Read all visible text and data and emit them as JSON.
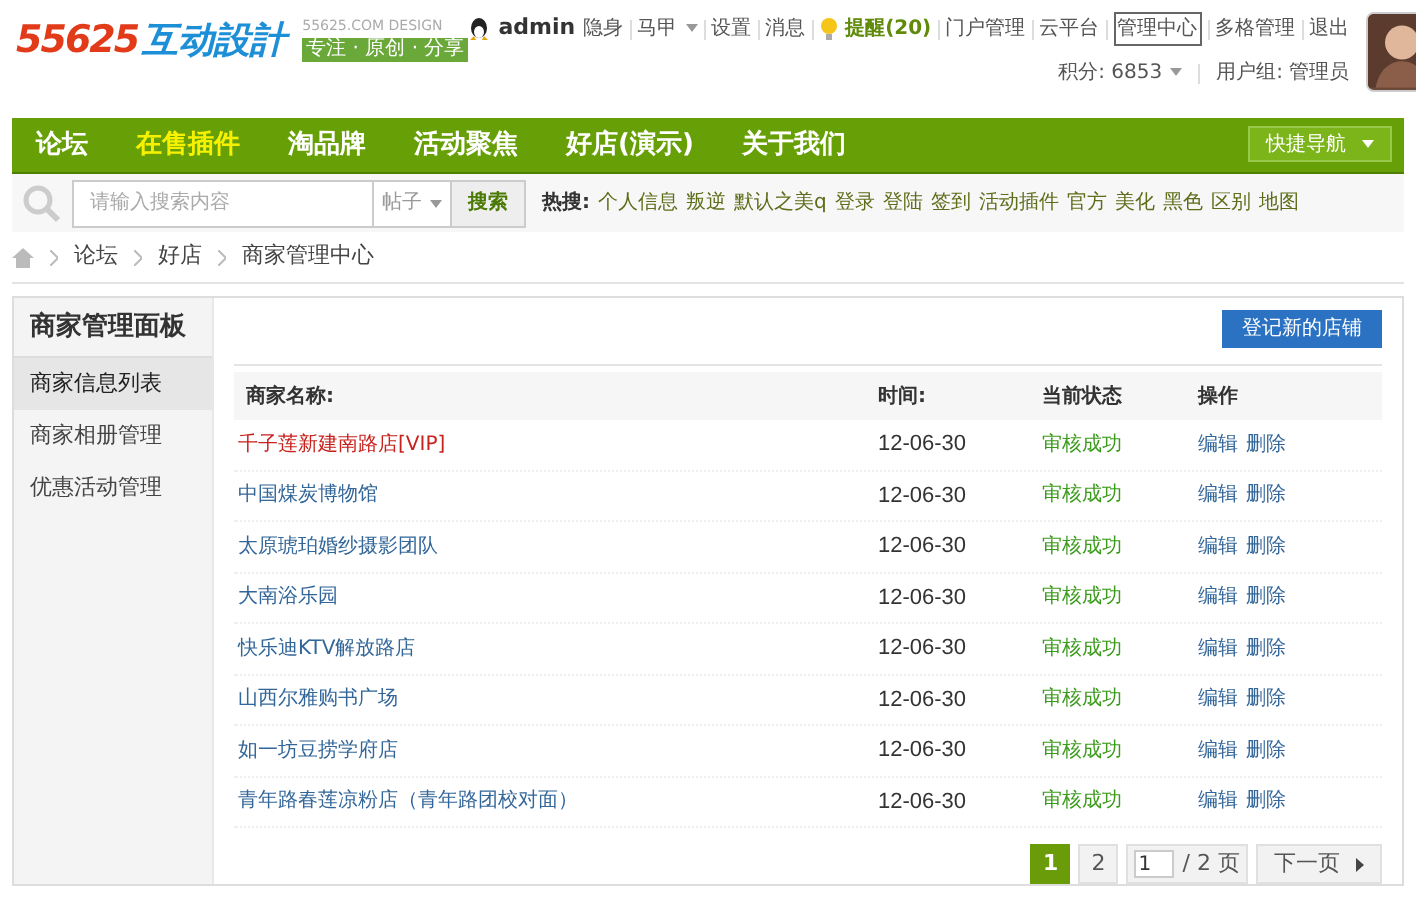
{
  "logo": {
    "digits": "55625",
    "brand": "互动設計",
    "domain": "55625.COM DESIGN",
    "slogan": "专注 · 原创 · 分享"
  },
  "user_bar": {
    "username": "admin",
    "status": "隐身",
    "links": [
      {
        "label": "马甲",
        "kind": "dropdown",
        "boxed": false
      },
      {
        "label": "设置",
        "kind": "link",
        "boxed": false
      },
      {
        "label": "消息",
        "kind": "link",
        "boxed": false
      },
      {
        "label": "提醒(20)",
        "kind": "alert",
        "boxed": false
      },
      {
        "label": "门户管理",
        "kind": "link",
        "boxed": false
      },
      {
        "label": "云平台",
        "kind": "link",
        "boxed": false
      },
      {
        "label": "管理中心",
        "kind": "link",
        "boxed": true
      },
      {
        "label": "多格管理",
        "kind": "link",
        "boxed": false
      },
      {
        "label": "退出",
        "kind": "link",
        "boxed": false
      }
    ],
    "points": "积分: 6853",
    "group": "用户组: 管理员"
  },
  "nav": {
    "items": [
      {
        "label": "论坛",
        "selected": false
      },
      {
        "label": "在售插件",
        "selected": true
      },
      {
        "label": "淘品牌",
        "selected": false
      },
      {
        "label": "活动聚焦",
        "selected": false
      },
      {
        "label": "好店(演示)",
        "selected": false
      },
      {
        "label": "关于我们",
        "selected": false
      }
    ],
    "quick_nav": "快捷导航"
  },
  "search": {
    "placeholder": "请输入搜索内容",
    "scope": "帖子",
    "button": "搜索",
    "hot_label": "热搜:",
    "hot": [
      "个人信息",
      "叛逆",
      "默认之美q",
      "登录",
      "登陆",
      "签到",
      "活动插件",
      "官方",
      "美化",
      "黑色",
      "区别",
      "地图"
    ]
  },
  "breadcrumb": [
    "论坛",
    "好店",
    "商家管理中心"
  ],
  "sidebar": {
    "title": "商家管理面板",
    "items": [
      {
        "label": "商家信息列表",
        "selected": true
      },
      {
        "label": "商家相册管理",
        "selected": false
      },
      {
        "label": "优惠活动管理",
        "selected": false
      }
    ]
  },
  "register_button": "登记新的店铺",
  "table": {
    "columns": [
      "商家名称:",
      "时间:",
      "当前状态",
      "操作"
    ],
    "rows": [
      {
        "name": "千子莲新建南路店[VIP]",
        "vip": true,
        "time": "12-06-30",
        "status": "审核成功",
        "actions": [
          "编辑",
          "删除"
        ]
      },
      {
        "name": "中国煤炭博物馆",
        "vip": false,
        "time": "12-06-30",
        "status": "审核成功",
        "actions": [
          "编辑",
          "删除"
        ]
      },
      {
        "name": "太原琥珀婚纱摄影团队",
        "vip": false,
        "time": "12-06-30",
        "status": "审核成功",
        "actions": [
          "编辑",
          "删除"
        ]
      },
      {
        "name": "大南浴乐园",
        "vip": false,
        "time": "12-06-30",
        "status": "审核成功",
        "actions": [
          "编辑",
          "删除"
        ]
      },
      {
        "name": "快乐迪KTV解放路店",
        "vip": false,
        "time": "12-06-30",
        "status": "审核成功",
        "actions": [
          "编辑",
          "删除"
        ]
      },
      {
        "name": "山西尔雅购书广场",
        "vip": false,
        "time": "12-06-30",
        "status": "审核成功",
        "actions": [
          "编辑",
          "删除"
        ]
      },
      {
        "name": "如一坊豆捞学府店",
        "vip": false,
        "time": "12-06-30",
        "status": "审核成功",
        "actions": [
          "编辑",
          "删除"
        ]
      },
      {
        "name": "青年路春莲凉粉店（青年路团校对面）",
        "vip": false,
        "time": "12-06-30",
        "status": "审核成功",
        "actions": [
          "编辑",
          "删除"
        ]
      }
    ]
  },
  "pagination": {
    "pages": [
      {
        "label": "1",
        "selected": true
      },
      {
        "label": "2",
        "selected": false
      }
    ],
    "page_input": "1",
    "total": "/ 2 页",
    "next": "下一页"
  }
}
